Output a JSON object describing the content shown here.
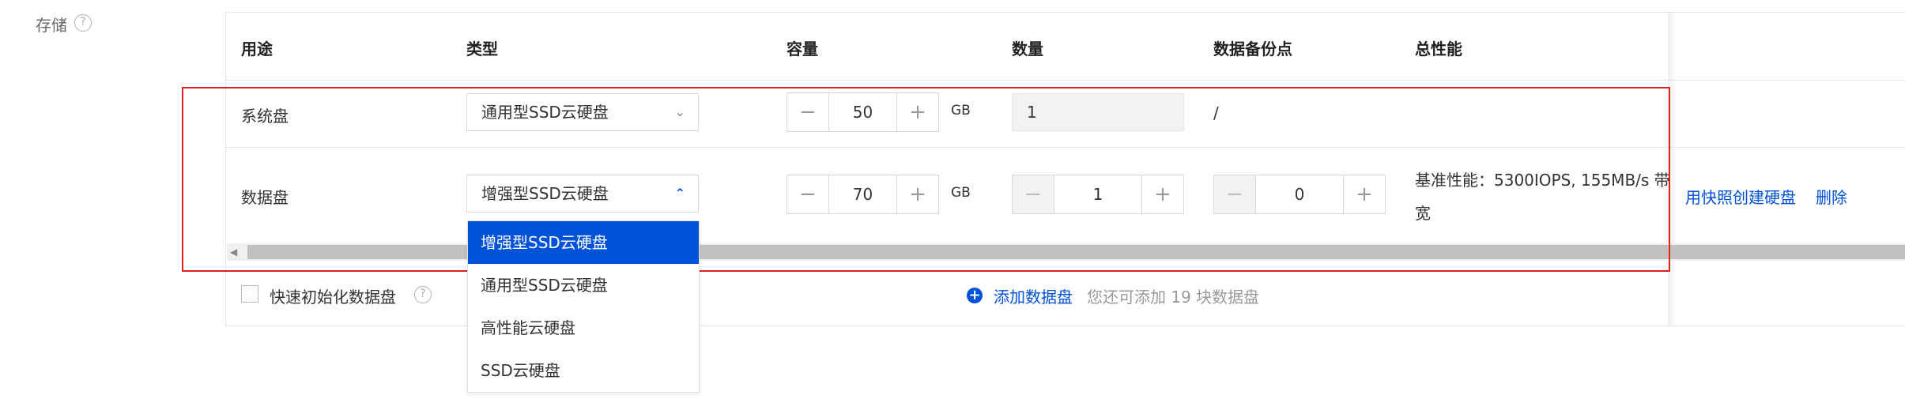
{
  "storage": {
    "label": "存储",
    "help_icon": "?"
  },
  "table": {
    "headers": [
      "用途",
      "类型",
      "容量",
      "数量",
      "数据备份点",
      "总性能"
    ],
    "rows": [
      {
        "usage": "系统盘",
        "type": "通用型SSD云硬盘",
        "capacity": "50",
        "unit": "GB",
        "quantity": "1",
        "backup": "/",
        "performance": ""
      },
      {
        "usage": "数据盘",
        "type": "增强型SSD云硬盘",
        "capacity": "70",
        "unit": "GB",
        "quantity": "1",
        "backup": "0",
        "performance_line1": "基准性能：5300IOPS, 155MB/s 带",
        "performance_line2": "宽",
        "action_snapshot": "用快照创建硬盘",
        "action_delete": "删除"
      }
    ]
  },
  "stepper": {
    "minus": "−",
    "plus": "+"
  },
  "dropdown": {
    "options": [
      "增强型SSD云硬盘",
      "通用型SSD云硬盘",
      "高性能云硬盘",
      "SSD云硬盘"
    ],
    "selected": "增强型SSD云硬盘"
  },
  "footer": {
    "quick_init_label": "快速初始化数据盘",
    "add_disk_label": "添加数据盘",
    "add_disk_hint": "您还可添加 19 块数据盘"
  },
  "icons": {
    "chevron_down": "chevron-down-icon",
    "chevron_up": "chevron-up-icon",
    "help": "question-circle-icon",
    "add": "plus-circle-icon"
  },
  "colors": {
    "accent": "#0052d9",
    "highlight_border": "#e0201b"
  }
}
